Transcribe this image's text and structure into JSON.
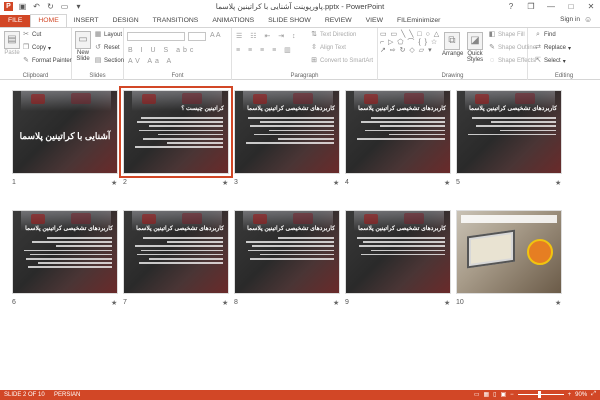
{
  "titlebar": {
    "title": "پاورپوینت آشنایی با کراتینین پلاسما.pptx - PowerPoint",
    "qat": [
      "ppt-logo-icon",
      "save-icon",
      "undo-icon",
      "redo-icon",
      "start-from-beginning-icon",
      "customize-qat-icon"
    ],
    "ppt_logo_glyph": "P",
    "controls": {
      "help": "?",
      "restore": "❐",
      "minimize": "—",
      "maximize": "□",
      "close": "✕"
    }
  },
  "tabs": {
    "file": "FILE",
    "items": [
      "HOME",
      "INSERT",
      "DESIGN",
      "TRANSITIONS",
      "ANIMATIONS",
      "SLIDE SHOW",
      "REVIEW",
      "VIEW",
      "FILEminimizer"
    ],
    "active": "HOME",
    "signin": "Sign in"
  },
  "ribbon": {
    "clipboard": {
      "label": "Clipboard",
      "paste": "Paste",
      "cut": "Cut",
      "copy": "Copy",
      "format_painter": "Format Painter"
    },
    "slides": {
      "label": "Slides",
      "new_slide": "New Slide",
      "layout": "Layout",
      "reset": "Reset",
      "section": "Section"
    },
    "font": {
      "label": "Font"
    },
    "paragraph": {
      "label": "Paragraph",
      "text_direction": "Text Direction",
      "align_text": "Align Text",
      "convert_smartart": "Convert to SmartArt"
    },
    "drawing": {
      "label": "Drawing",
      "arrange": "Arrange",
      "quick_styles": "Quick Styles",
      "shape_fill": "Shape Fill",
      "shape_outline": "Shape Outline",
      "shape_effects": "Shape Effects"
    },
    "editing": {
      "label": "Editing",
      "find": "Find",
      "replace": "Replace",
      "select": "Select"
    }
  },
  "slides": [
    {
      "num": "1",
      "type": "cover",
      "title": "آشنایی با کراتینین پلاسما",
      "selected": false
    },
    {
      "num": "2",
      "type": "text",
      "title": "کراتینین چیست ؟",
      "selected": true
    },
    {
      "num": "3",
      "type": "text",
      "title": "کاربردهای تشخیصی کراتینین پلاسما",
      "selected": false
    },
    {
      "num": "4",
      "type": "text",
      "title": "کاربردهای تشخیصی کراتینین پلاسما",
      "selected": false
    },
    {
      "num": "5",
      "type": "text",
      "title": "کاربردهای تشخیصی کراتینین پلاسما",
      "selected": false
    },
    {
      "num": "6",
      "type": "text",
      "title": "کاربردهای تشخیصی کراتینین پلاسما",
      "selected": false
    },
    {
      "num": "7",
      "type": "text",
      "title": "کاربردهای تشخیصی کراتینین پلاسما",
      "selected": false
    },
    {
      "num": "8",
      "type": "text",
      "title": "کاربردهای تشخیصی کراتینین پلاسما",
      "selected": false
    },
    {
      "num": "9",
      "type": "text",
      "title": "کاربردهای تشخیصی کراتینین پلاسما",
      "selected": false
    },
    {
      "num": "10",
      "type": "image",
      "title": "",
      "selected": false
    }
  ],
  "slide_star": "★",
  "status": {
    "slide_info": "SLIDE 2 OF 10",
    "language": "PERSIAN",
    "zoom": "90%"
  },
  "colors": {
    "accent": "#d24726"
  }
}
